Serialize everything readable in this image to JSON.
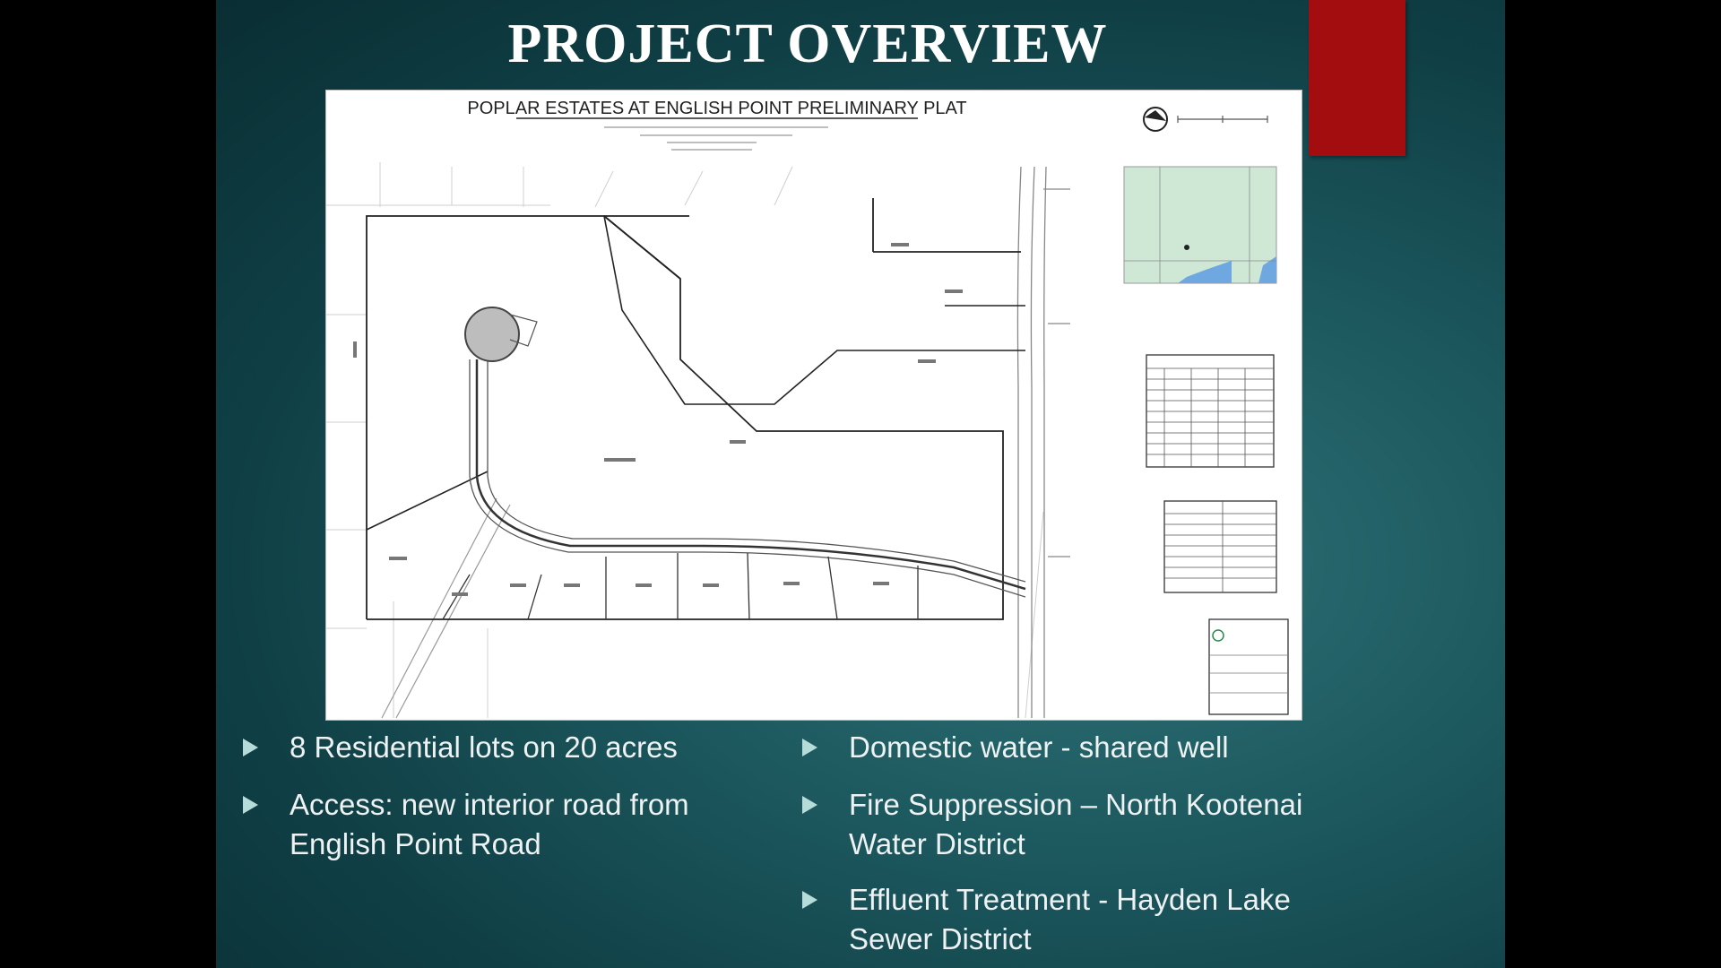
{
  "slide": {
    "title": "PROJECT OVERVIEW",
    "plat": {
      "heading": "POPLAR ESTATES AT ENGLISH POINT PRELIMINARY PLAT"
    },
    "bullets_left": [
      {
        "line1": "8 Residential lots on 20 acres",
        "line2": ""
      },
      {
        "line1": "Access:  new interior road from",
        "line2": "English Point Road"
      }
    ],
    "bullets_right": [
      {
        "line1": "Domestic water - shared well",
        "line2": ""
      },
      {
        "line1": "Fire Suppression – North Kootenai",
        "line2": "Water District"
      },
      {
        "line1": "Effluent Treatment - Hayden Lake",
        "line2": "Sewer District"
      }
    ],
    "colors": {
      "background": "#1d5a60",
      "accent_red": "#a30d10",
      "bullet_arrow": "#b6dcd9"
    }
  }
}
